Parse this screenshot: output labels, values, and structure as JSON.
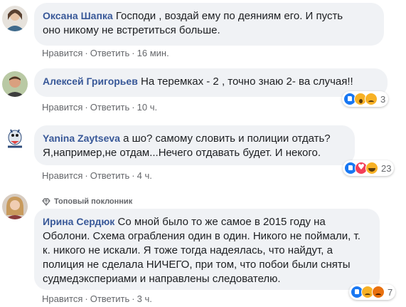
{
  "comments": [
    {
      "author": "Оксана Шапка",
      "text_line1": "Господи , воздай ему по деяниям его. И пусть",
      "text_line2": "оно никому не встретиться больше.",
      "like_label": "Нравится",
      "reply_label": "Ответить",
      "time": "16 мин."
    },
    {
      "author": "Алексей Григорьев",
      "text_line1": "На теремках - 2 , точно знаю 2- ва случая!!",
      "like_label": "Нравится",
      "reply_label": "Ответить",
      "time": "10 ч.",
      "reactions": {
        "icons": [
          "like",
          "wow",
          "sad"
        ],
        "count": "3"
      }
    },
    {
      "author": "Yanina Zaytseva",
      "text_line1": "а шо? самому словить и полиции отдать?",
      "text_line2": "Я,например,не отдам...Нечего отдавать будет. И некого.",
      "like_label": "Нравится",
      "reply_label": "Ответить",
      "time": "4 ч.",
      "reactions": {
        "icons": [
          "like",
          "love",
          "haha"
        ],
        "count": "23"
      }
    },
    {
      "badge": "Топовый поклонник",
      "badge_icon": "diamond-icon",
      "author": "Ирина Сердюк",
      "text_line1": "Со мной было то же самое в 2015 году на",
      "text_line2": "Оболони. Схема ограбления один в один. Никого не поймали, т.",
      "text_line3": "к. никого не искали. Я тоже тогда надеялась, что найдут, а",
      "text_line4": "полиция не сделала НИЧЕГО, при том, что побои были сняты",
      "text_line5": "судмедэкспериами и направлены следователю.",
      "like_label": "Нравится",
      "reply_label": "Ответить",
      "time": "3 ч.",
      "reactions": {
        "icons": [
          "like",
          "sad",
          "angry"
        ],
        "count": "7"
      }
    }
  ],
  "separator": "·",
  "colors": {
    "bubble": "#f0f2f5",
    "author": "#385898",
    "meta": "#65676b",
    "like": "#1877f2"
  }
}
